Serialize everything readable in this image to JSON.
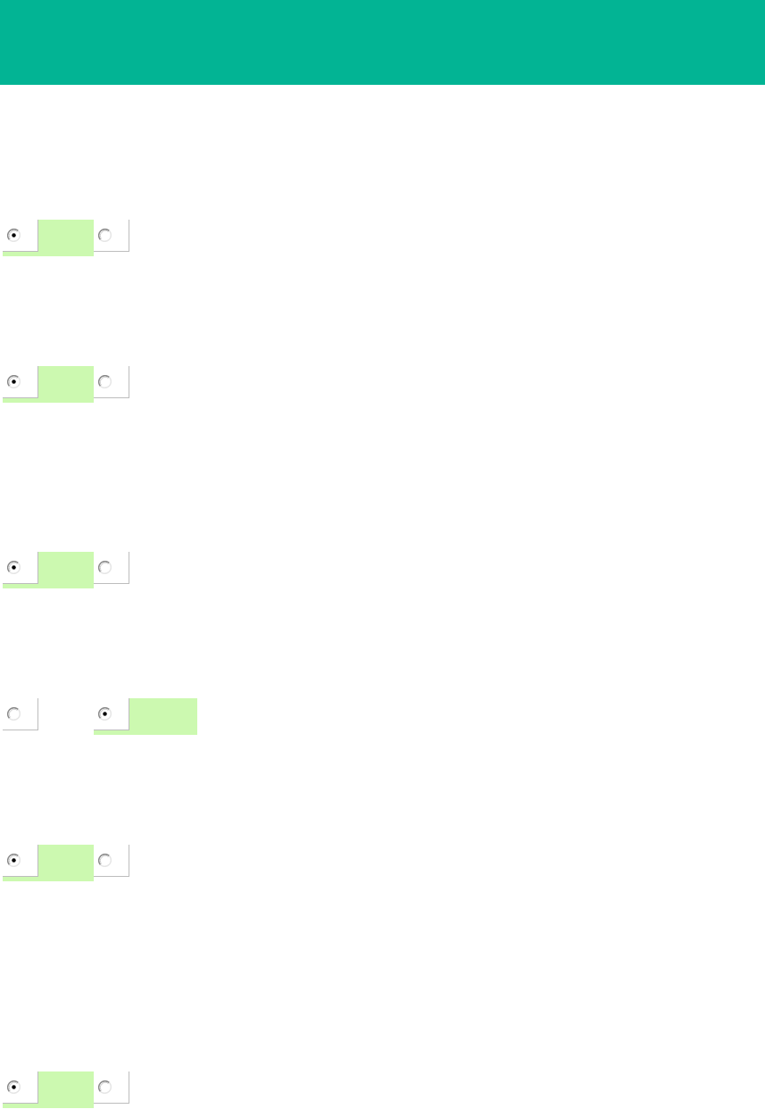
{
  "radio_groups": [
    {
      "options": [
        {
          "selected": true
        },
        {
          "selected": false
        }
      ]
    },
    {
      "options": [
        {
          "selected": true
        },
        {
          "selected": false
        }
      ]
    },
    {
      "options": [
        {
          "selected": true
        },
        {
          "selected": false
        }
      ]
    },
    {
      "options": [
        {
          "selected": false
        },
        {
          "selected": true
        }
      ]
    },
    {
      "options": [
        {
          "selected": true
        },
        {
          "selected": false
        }
      ]
    },
    {
      "options": [
        {
          "selected": true
        },
        {
          "selected": false
        }
      ]
    }
  ]
}
